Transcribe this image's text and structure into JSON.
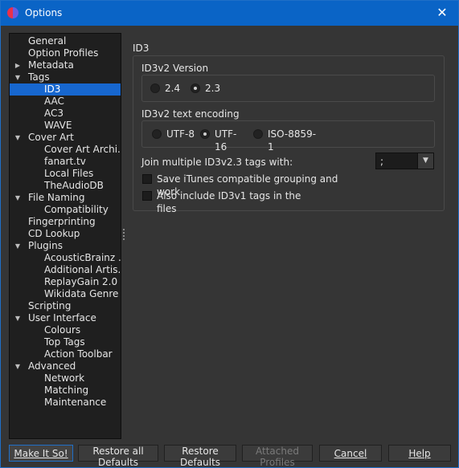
{
  "window": {
    "title": "Options",
    "close_glyph": "✕",
    "app_icon": "picard-icon"
  },
  "tree": [
    {
      "label": "General",
      "level": 0,
      "arrow": ""
    },
    {
      "label": "Option Profiles",
      "level": 0,
      "arrow": ""
    },
    {
      "label": "Metadata",
      "level": 0,
      "arrow": "collapsed"
    },
    {
      "label": "Tags",
      "level": 0,
      "arrow": "expanded"
    },
    {
      "label": "ID3",
      "level": 1,
      "arrow": "",
      "selected": true
    },
    {
      "label": "AAC",
      "level": 1,
      "arrow": ""
    },
    {
      "label": "AC3",
      "level": 1,
      "arrow": ""
    },
    {
      "label": "WAVE",
      "level": 1,
      "arrow": ""
    },
    {
      "label": "Cover Art",
      "level": 0,
      "arrow": "expanded"
    },
    {
      "label": "Cover Art Archi...",
      "level": 1,
      "arrow": ""
    },
    {
      "label": "fanart.tv",
      "level": 1,
      "arrow": ""
    },
    {
      "label": "Local Files",
      "level": 1,
      "arrow": ""
    },
    {
      "label": "TheAudioDB",
      "level": 1,
      "arrow": ""
    },
    {
      "label": "File Naming",
      "level": 0,
      "arrow": "expanded"
    },
    {
      "label": "Compatibility",
      "level": 1,
      "arrow": ""
    },
    {
      "label": "Fingerprinting",
      "level": 0,
      "arrow": ""
    },
    {
      "label": "CD Lookup",
      "level": 0,
      "arrow": ""
    },
    {
      "label": "Plugins",
      "level": 0,
      "arrow": "expanded"
    },
    {
      "label": "AcousticBrainz ...",
      "level": 1,
      "arrow": ""
    },
    {
      "label": "Additional Artis...",
      "level": 1,
      "arrow": ""
    },
    {
      "label": "ReplayGain 2.0",
      "level": 1,
      "arrow": ""
    },
    {
      "label": "Wikidata Genre",
      "level": 1,
      "arrow": ""
    },
    {
      "label": "Scripting",
      "level": 0,
      "arrow": ""
    },
    {
      "label": "User Interface",
      "level": 0,
      "arrow": "expanded"
    },
    {
      "label": "Colours",
      "level": 1,
      "arrow": ""
    },
    {
      "label": "Top Tags",
      "level": 1,
      "arrow": ""
    },
    {
      "label": "Action Toolbar",
      "level": 1,
      "arrow": ""
    },
    {
      "label": "Advanced",
      "level": 0,
      "arrow": "expanded"
    },
    {
      "label": "Network",
      "level": 1,
      "arrow": ""
    },
    {
      "label": "Matching",
      "level": 1,
      "arrow": ""
    },
    {
      "label": "Maintenance",
      "level": 1,
      "arrow": ""
    }
  ],
  "panel": {
    "section_title": "ID3",
    "version_label": "ID3v2 Version",
    "version_options": [
      {
        "label": "2.4",
        "checked": false
      },
      {
        "label": "2.3",
        "checked": true
      }
    ],
    "encoding_label": "ID3v2 text encoding",
    "encoding_options": [
      {
        "label": "UTF-8",
        "checked": false
      },
      {
        "label": "UTF-16",
        "checked": true
      },
      {
        "label": "ISO-8859-1",
        "checked": false
      }
    ],
    "join_label": "Join multiple ID3v2.3 tags with:",
    "join_value": ";",
    "itunes_label": "Save iTunes compatible grouping and work",
    "itunes_checked": false,
    "id3v1_label": "Also include ID3v1 tags in the files",
    "id3v1_checked": false
  },
  "buttons": {
    "make_it_so": "Make It So!",
    "restore_all": "Restore all Defaults",
    "restore": "Restore Defaults",
    "attached_profiles": "Attached Profiles",
    "cancel": "Cancel",
    "help": "Help"
  },
  "colors": {
    "titlebar": "#0a64c6",
    "selection": "#1767cf",
    "background": "#353535"
  }
}
